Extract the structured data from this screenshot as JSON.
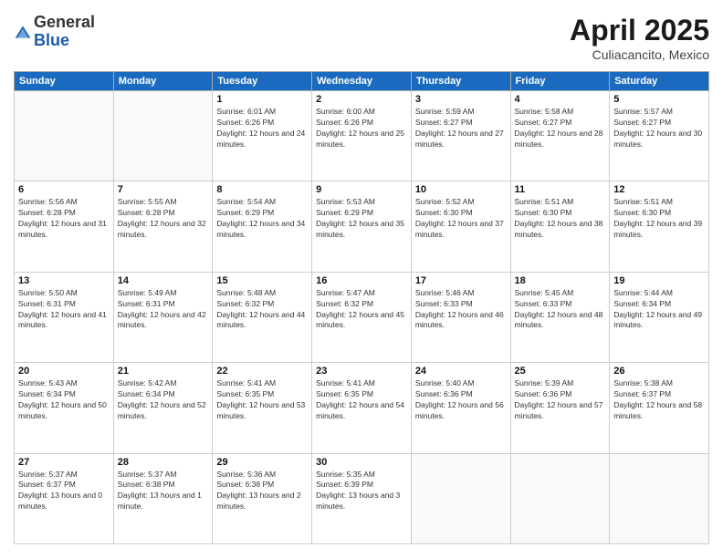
{
  "header": {
    "logo_general": "General",
    "logo_blue": "Blue",
    "month_title": "April 2025",
    "location": "Culiacancito, Mexico"
  },
  "weekdays": [
    "Sunday",
    "Monday",
    "Tuesday",
    "Wednesday",
    "Thursday",
    "Friday",
    "Saturday"
  ],
  "weeks": [
    [
      {
        "day": "",
        "info": ""
      },
      {
        "day": "",
        "info": ""
      },
      {
        "day": "1",
        "info": "Sunrise: 6:01 AM\nSunset: 6:26 PM\nDaylight: 12 hours and 24 minutes."
      },
      {
        "day": "2",
        "info": "Sunrise: 6:00 AM\nSunset: 6:26 PM\nDaylight: 12 hours and 25 minutes."
      },
      {
        "day": "3",
        "info": "Sunrise: 5:59 AM\nSunset: 6:27 PM\nDaylight: 12 hours and 27 minutes."
      },
      {
        "day": "4",
        "info": "Sunrise: 5:58 AM\nSunset: 6:27 PM\nDaylight: 12 hours and 28 minutes."
      },
      {
        "day": "5",
        "info": "Sunrise: 5:57 AM\nSunset: 6:27 PM\nDaylight: 12 hours and 30 minutes."
      }
    ],
    [
      {
        "day": "6",
        "info": "Sunrise: 5:56 AM\nSunset: 6:28 PM\nDaylight: 12 hours and 31 minutes."
      },
      {
        "day": "7",
        "info": "Sunrise: 5:55 AM\nSunset: 6:28 PM\nDaylight: 12 hours and 32 minutes."
      },
      {
        "day": "8",
        "info": "Sunrise: 5:54 AM\nSunset: 6:29 PM\nDaylight: 12 hours and 34 minutes."
      },
      {
        "day": "9",
        "info": "Sunrise: 5:53 AM\nSunset: 6:29 PM\nDaylight: 12 hours and 35 minutes."
      },
      {
        "day": "10",
        "info": "Sunrise: 5:52 AM\nSunset: 6:30 PM\nDaylight: 12 hours and 37 minutes."
      },
      {
        "day": "11",
        "info": "Sunrise: 5:51 AM\nSunset: 6:30 PM\nDaylight: 12 hours and 38 minutes."
      },
      {
        "day": "12",
        "info": "Sunrise: 5:51 AM\nSunset: 6:30 PM\nDaylight: 12 hours and 39 minutes."
      }
    ],
    [
      {
        "day": "13",
        "info": "Sunrise: 5:50 AM\nSunset: 6:31 PM\nDaylight: 12 hours and 41 minutes."
      },
      {
        "day": "14",
        "info": "Sunrise: 5:49 AM\nSunset: 6:31 PM\nDaylight: 12 hours and 42 minutes."
      },
      {
        "day": "15",
        "info": "Sunrise: 5:48 AM\nSunset: 6:32 PM\nDaylight: 12 hours and 44 minutes."
      },
      {
        "day": "16",
        "info": "Sunrise: 5:47 AM\nSunset: 6:32 PM\nDaylight: 12 hours and 45 minutes."
      },
      {
        "day": "17",
        "info": "Sunrise: 5:46 AM\nSunset: 6:33 PM\nDaylight: 12 hours and 46 minutes."
      },
      {
        "day": "18",
        "info": "Sunrise: 5:45 AM\nSunset: 6:33 PM\nDaylight: 12 hours and 48 minutes."
      },
      {
        "day": "19",
        "info": "Sunrise: 5:44 AM\nSunset: 6:34 PM\nDaylight: 12 hours and 49 minutes."
      }
    ],
    [
      {
        "day": "20",
        "info": "Sunrise: 5:43 AM\nSunset: 6:34 PM\nDaylight: 12 hours and 50 minutes."
      },
      {
        "day": "21",
        "info": "Sunrise: 5:42 AM\nSunset: 6:34 PM\nDaylight: 12 hours and 52 minutes."
      },
      {
        "day": "22",
        "info": "Sunrise: 5:41 AM\nSunset: 6:35 PM\nDaylight: 12 hours and 53 minutes."
      },
      {
        "day": "23",
        "info": "Sunrise: 5:41 AM\nSunset: 6:35 PM\nDaylight: 12 hours and 54 minutes."
      },
      {
        "day": "24",
        "info": "Sunrise: 5:40 AM\nSunset: 6:36 PM\nDaylight: 12 hours and 56 minutes."
      },
      {
        "day": "25",
        "info": "Sunrise: 5:39 AM\nSunset: 6:36 PM\nDaylight: 12 hours and 57 minutes."
      },
      {
        "day": "26",
        "info": "Sunrise: 5:38 AM\nSunset: 6:37 PM\nDaylight: 12 hours and 58 minutes."
      }
    ],
    [
      {
        "day": "27",
        "info": "Sunrise: 5:37 AM\nSunset: 6:37 PM\nDaylight: 13 hours and 0 minutes."
      },
      {
        "day": "28",
        "info": "Sunrise: 5:37 AM\nSunset: 6:38 PM\nDaylight: 13 hours and 1 minute."
      },
      {
        "day": "29",
        "info": "Sunrise: 5:36 AM\nSunset: 6:38 PM\nDaylight: 13 hours and 2 minutes."
      },
      {
        "day": "30",
        "info": "Sunrise: 5:35 AM\nSunset: 6:39 PM\nDaylight: 13 hours and 3 minutes."
      },
      {
        "day": "",
        "info": ""
      },
      {
        "day": "",
        "info": ""
      },
      {
        "day": "",
        "info": ""
      }
    ]
  ]
}
